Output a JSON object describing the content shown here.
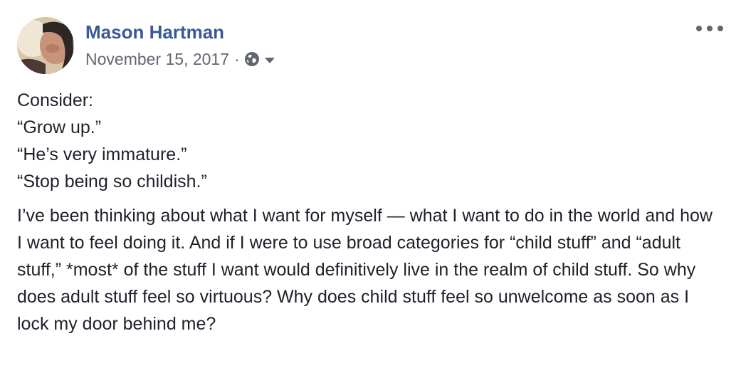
{
  "post": {
    "author": "Mason Hartman",
    "date": "November 15, 2017",
    "separator": "·",
    "audience_icon": "globe-icon",
    "audience_menu_icon": "caret-down-icon",
    "options_icon": "more-options-icon",
    "link_color": "#385898",
    "secondary_color": "#606770",
    "text_color": "#1d2129",
    "lines": [
      "Consider:",
      "“Grow up.”",
      "“He’s very immature.”",
      "“Stop being so childish.”"
    ],
    "paragraph": "I’ve been thinking about what I want for myself — what I want to do in the world and how I want to feel doing it. And if I were to use broad categories for “child stuff” and “adult stuff,” *most* of the stuff I want would definitively live in the realm of child stuff. So why does adult stuff feel so virtuous? Why does child stuff feel so unwelcome as soon as I lock my door behind me?"
  }
}
